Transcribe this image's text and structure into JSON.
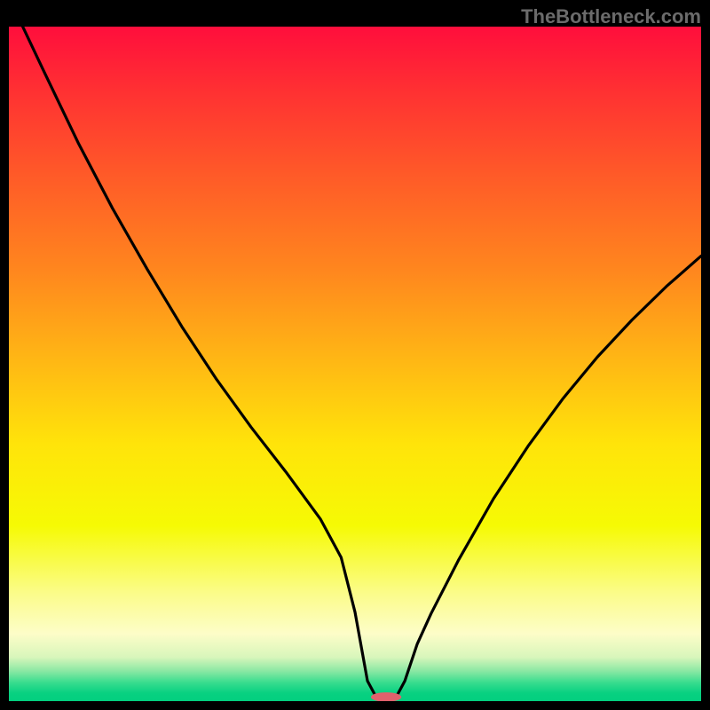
{
  "watermark": "TheBottleneck.com",
  "chart_data": {
    "type": "line",
    "title": "",
    "xlabel": "",
    "ylabel": "",
    "xlim": [
      0,
      100
    ],
    "ylim": [
      0,
      100
    ],
    "grid": false,
    "legend": false,
    "annotations": [],
    "x": [
      2,
      5,
      10,
      15,
      20,
      25,
      30,
      35,
      40,
      45,
      48,
      50,
      51.8,
      53.0,
      54.0,
      55.0,
      56.0,
      57.2,
      59.0,
      61,
      65,
      70,
      75,
      80,
      85,
      90,
      95,
      100
    ],
    "values": [
      100.0,
      93.5,
      82.8,
      73.0,
      64.0,
      55.5,
      47.7,
      40.6,
      34.0,
      27.0,
      21.3,
      13.2,
      3.0,
      0.7,
      0.0,
      0.0,
      0.7,
      3.0,
      8.5,
      13.0,
      21.0,
      30.0,
      37.8,
      44.8,
      51.0,
      56.5,
      61.5,
      66.0
    ],
    "marker": {
      "x_center": 54.5,
      "rx_pct": 2.2,
      "ry_pct": 0.7,
      "color": "#e0616c"
    },
    "gradient_stops": [
      {
        "offset": 0.0,
        "color": "#ff0e3c"
      },
      {
        "offset": 0.1,
        "color": "#ff3232"
      },
      {
        "offset": 0.22,
        "color": "#ff5a28"
      },
      {
        "offset": 0.36,
        "color": "#ff861e"
      },
      {
        "offset": 0.5,
        "color": "#ffb914"
      },
      {
        "offset": 0.62,
        "color": "#ffe40a"
      },
      {
        "offset": 0.74,
        "color": "#f6fa04"
      },
      {
        "offset": 0.84,
        "color": "#fbfc8a"
      },
      {
        "offset": 0.9,
        "color": "#fdfdc8"
      },
      {
        "offset": 0.935,
        "color": "#d8f6bb"
      },
      {
        "offset": 0.955,
        "color": "#8ce8a4"
      },
      {
        "offset": 0.972,
        "color": "#3add8f"
      },
      {
        "offset": 0.988,
        "color": "#08d181"
      },
      {
        "offset": 1.0,
        "color": "#03cf7f"
      }
    ],
    "line_color": "#000000",
    "line_width": 3.2
  }
}
